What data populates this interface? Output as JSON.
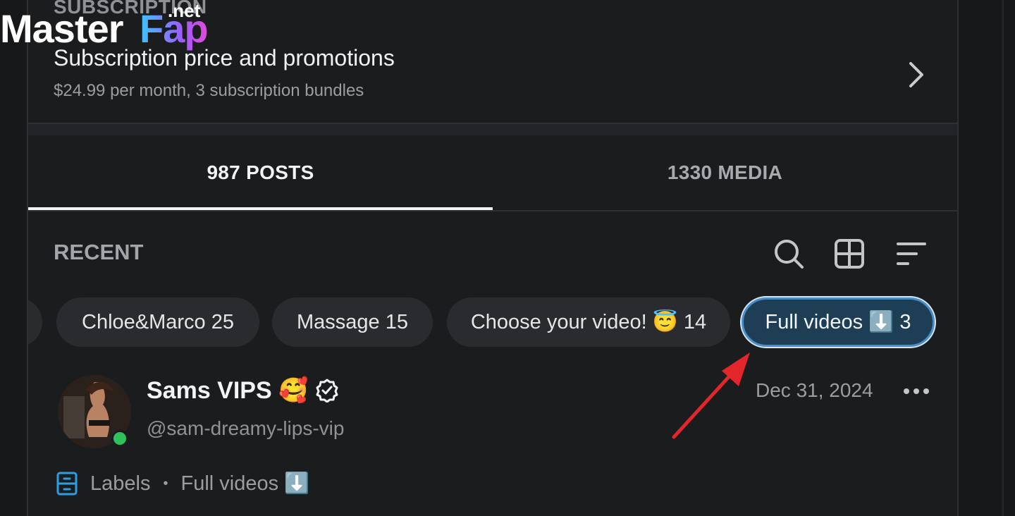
{
  "watermark": {
    "brand_a": "Master",
    "brand_b": "Fap",
    "suffix": ".net"
  },
  "subscription": {
    "section_title": "SUBSCRIPTION",
    "title": "Subscription price and promotions",
    "subtitle": "$24.99 per month, 3 subscription bundles",
    "chevron_icon": "chevron-right-icon"
  },
  "tabs": [
    {
      "label": "987 POSTS",
      "active": true
    },
    {
      "label": "1330 MEDIA",
      "active": false
    }
  ],
  "recent": {
    "label": "RECENT",
    "tools": [
      "search-icon",
      "grid-icon",
      "sort-icon"
    ]
  },
  "chips": [
    {
      "label": "Chloe&Marco 25"
    },
    {
      "label": "Massage 15"
    },
    {
      "label": "Choose your video! 😇 14"
    },
    {
      "label": "Full videos ⬇️ 3",
      "active": true
    }
  ],
  "post": {
    "display_name": "Sams VIPS 🥰",
    "handle": "@sam-dreamy-lips-vip",
    "date": "Dec 31, 2024",
    "labels_label": "Labels",
    "separator": "•",
    "label_value": "Full videos ⬇️"
  },
  "colors": {
    "background": "#1b1c1e",
    "active_chip_bg": "#1e3e55",
    "active_chip_border": "#4a8ec9",
    "online": "#2fc25a",
    "annotation_arrow": "#e3262b",
    "labels_icon": "#2b9fe0"
  }
}
